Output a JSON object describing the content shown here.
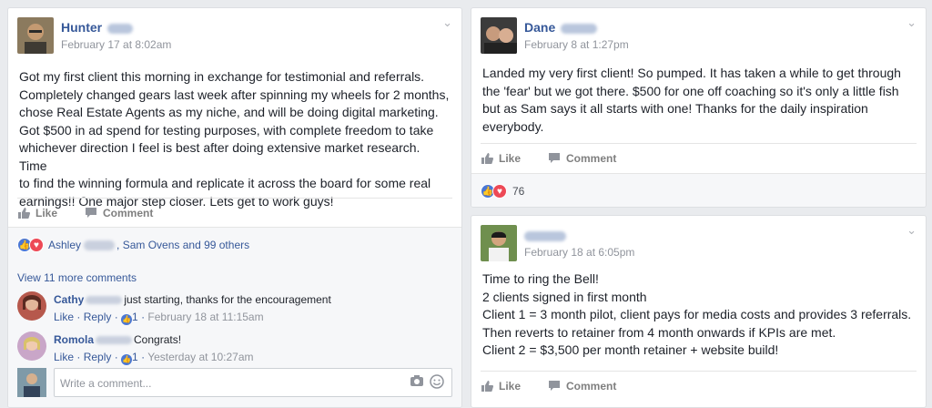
{
  "ui": {
    "like_label": "Like",
    "comment_label": "Comment"
  },
  "post1": {
    "author": "Hunter",
    "time": "February 17 at 8:02am",
    "text": "Got my first client this morning in exchange for testimonial and referrals.\nCompletely changed gears last week after spinning my wheels for 2 months,\nchose Real Estate Agents as my niche, and will be doing digital marketing.\nGot $500 in ad spend for testing purposes, with complete freedom to take\nwhichever direction I feel is best after doing extensive market research. Time\nto find the winning formula and replicate it across the board for some real\nearnings!! One major step closer. Lets get to work guys!",
    "reactions_first": "Ashley",
    "reactions_rest": ", Sam Ovens and 99 others",
    "view_more": "View 11 more comments",
    "comments": [
      {
        "author": "Cathy",
        "text": "just starting, thanks for the encouragement",
        "like": "Like",
        "reply": "Reply",
        "likes": "1",
        "time": "February 18 at 11:15am"
      },
      {
        "author": "Romola",
        "text": "Congrats!",
        "like": "Like",
        "reply": "Reply",
        "likes": "1",
        "time": "Yesterday at 10:27am"
      }
    ],
    "write_placeholder": "Write a comment..."
  },
  "post2": {
    "author": "Dane",
    "time": "February 8 at 1:27pm",
    "text": "Landed my very first client! So pumped. It has taken a while to get through\nthe 'fear' but we got there. $500 for one off coaching so it's only a little fish\nbut as Sam says it all starts with one! Thanks for the daily inspiration\neverybody.",
    "reaction_count": "76"
  },
  "post3": {
    "time": "February 18 at 6:05pm",
    "text": "Time to ring the Bell!\n2 clients signed in first month\nClient 1 = 3 month pilot, client pays for media costs and provides 3 referrals.\nThen reverts to retainer from 4 month onwards if KPIs are met.\nClient 2 = $3,500 per month retainer + website build!"
  },
  "colors": {
    "link": "#365899",
    "like_blue": "#4a77d4",
    "love_red": "#ed4956",
    "bg": "#e9ebee"
  }
}
